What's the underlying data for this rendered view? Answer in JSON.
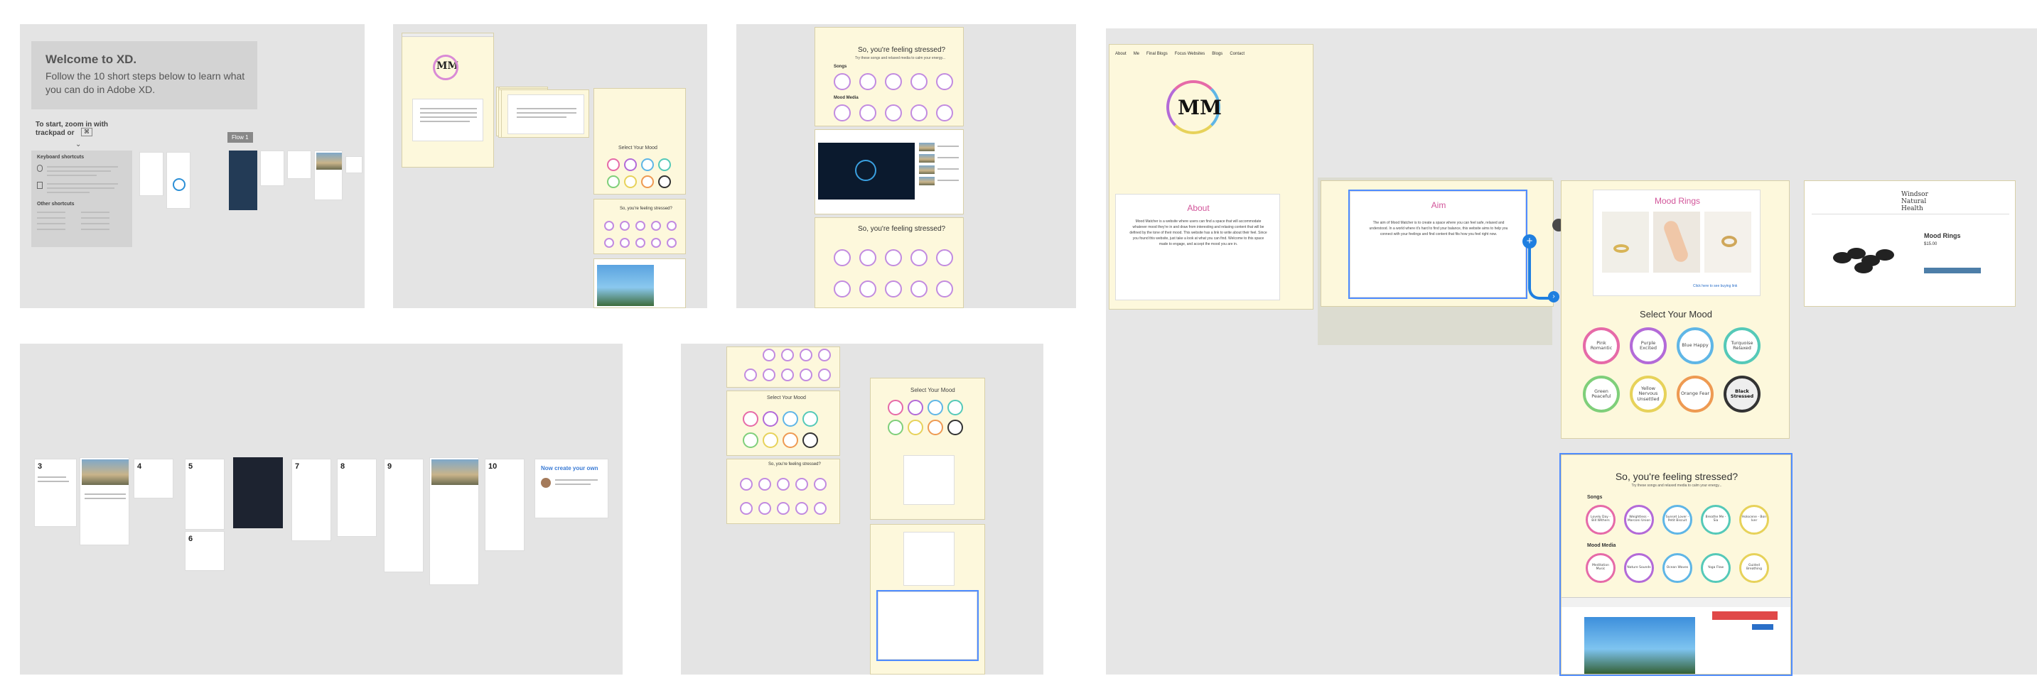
{
  "welcome": {
    "title": "Welcome to XD.",
    "subtitle": "Follow the 10 short steps below to learn what you can do in Adobe XD.",
    "zoom_hint_line1": "To start, zoom in with",
    "zoom_hint_line2": "trackpad or",
    "keyboard_title": "Keyboard shortcuts",
    "other_shortcuts": "Other shortcuts",
    "flow_label": "Flow 1"
  },
  "tutorial": {
    "steps": [
      "3",
      "4",
      "5",
      "6",
      "7",
      "8",
      "9",
      "10"
    ],
    "create_own": "Now create your own"
  },
  "site": {
    "nav": [
      "About",
      "Me",
      "Final Blogs",
      "Focus Websites",
      "Blogs",
      "Contact"
    ],
    "logo": "MM",
    "about_heading": "About",
    "about_text": "Mood Matcher is a website where users can find a space that will accommodate whatever mood they're in and draw from interesting and relaxing content that will be defined by the tone of their mood. This website has a link to write about their feel. Since you found this website, just take a look at what you can find. Welcome to this space made to engage, and accept the mood you are in.",
    "aim_heading": "Aim",
    "aim_text": "The aim of Mood Matcher is to create a space where you can feel safe, relaxed and understood. In a world where it's hard to find your balance, this website aims to help you connect with your feelings and find content that fits how you feel right now.",
    "mood_rings_heading": "Mood Rings",
    "mood_rings_link": "Click here to see buying link",
    "select_mood": "Select Your Mood",
    "moods": [
      {
        "label": "Pink Romantic",
        "color": "#e66aa8"
      },
      {
        "label": "Purple Excited",
        "color": "#b36ad8"
      },
      {
        "label": "Blue Happy",
        "color": "#5fb6e6"
      },
      {
        "label": "Turquoise Relaxed",
        "color": "#55c9b8"
      },
      {
        "label": "Green Peaceful",
        "color": "#7fcf7a"
      },
      {
        "label": "Yellow Nervous Unsettled",
        "color": "#e7d25a"
      },
      {
        "label": "Orange Fear",
        "color": "#ee9a52"
      },
      {
        "label": "Black Stressed",
        "color": "#333333"
      }
    ],
    "stressed_heading": "So, you're feeling stressed?",
    "stressed_sub": "Try these songs and relaxed media to calm your energy...",
    "songs_label": "Songs",
    "media_label": "Mood Media",
    "songs": [
      "Lovely Day - Bill Withers",
      "Weightless - Marconi Union",
      "Sunset Lover - Petit Biscuit",
      "Breathe Me - Sia",
      "Holocene - Bon Iver"
    ],
    "media": [
      "Meditation Music",
      "Nature Sounds",
      "Ocean Waves",
      "Yoga Flow",
      "Guided Breathing"
    ]
  },
  "shop": {
    "brand": "Windsor Natural Health",
    "product": "Mood Rings",
    "price": "$15.00"
  },
  "colors": {
    "canvas": "#e4e4e4",
    "artboard": "#fdf8dc",
    "selection": "#4f8cff",
    "flow_wire": "#1f7fe0"
  }
}
